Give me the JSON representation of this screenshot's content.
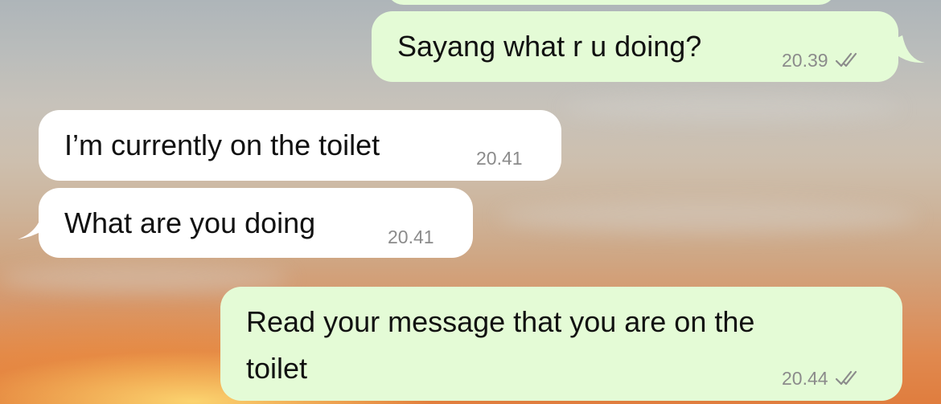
{
  "messages": [
    {
      "direction": "outgoing",
      "text": "Sayang what r u doing?",
      "time": "20.39",
      "status": "read-double-check"
    },
    {
      "direction": "incoming",
      "text": "I’m currently on the toilet",
      "time": "20.41"
    },
    {
      "direction": "incoming",
      "text": "What are you doing",
      "time": "20.41"
    },
    {
      "direction": "outgoing",
      "text_lines": [
        "Read your message that you are on the",
        "toilet"
      ],
      "time": "20.44",
      "status": "read-double-check"
    }
  ],
  "icons": {
    "read_receipt": "double-check-icon"
  },
  "colors": {
    "outgoing_bubble": "#e4fbd6",
    "incoming_bubble": "#ffffff",
    "timestamp": "#8b8b8b",
    "text": "#111111"
  }
}
